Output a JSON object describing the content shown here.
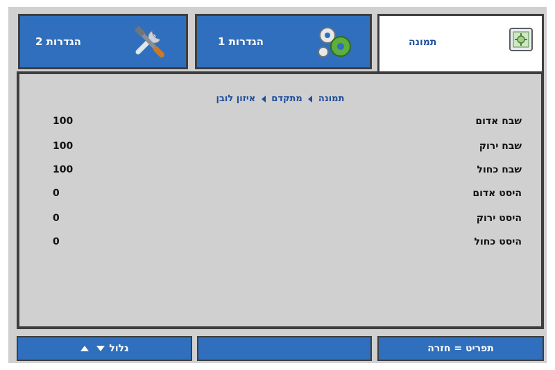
{
  "tabs": [
    {
      "label": "הגדרות 2",
      "icon": "tools-icon"
    },
    {
      "label": "הגדרות 1",
      "icon": "gears-icon"
    },
    {
      "label": "תמונה",
      "icon": "picture-icon"
    }
  ],
  "breadcrumb": [
    "תמונה",
    "מתקדם",
    "איזון לובן"
  ],
  "rows": [
    {
      "label": "שבח אדום",
      "value": "100"
    },
    {
      "label": "שבח ירוק",
      "value": "100"
    },
    {
      "label": "שבח כחול",
      "value": "100"
    },
    {
      "label": "היסט אדום",
      "value": "0"
    },
    {
      "label": "היסט ירוק",
      "value": "0"
    },
    {
      "label": "היסט כחול",
      "value": "0"
    }
  ],
  "bottom": {
    "scroll_label": "גלול",
    "menu_label": "תפריט = חזרה"
  }
}
